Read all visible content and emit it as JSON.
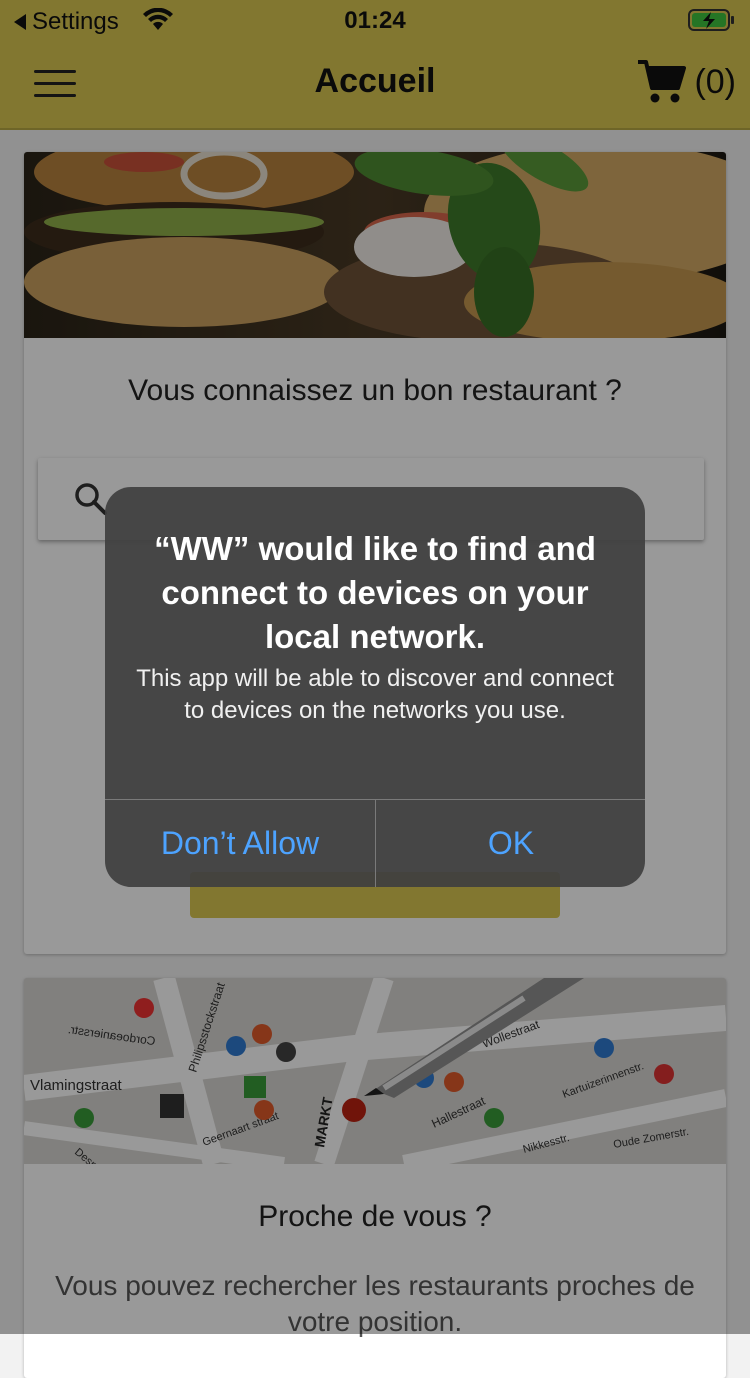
{
  "status_bar": {
    "back_label": "Settings",
    "time": "01:24"
  },
  "navbar": {
    "title": "Accueil",
    "cart_count": "(0)"
  },
  "card1": {
    "title": "Vous connaissez un bon restaurant ?"
  },
  "card2": {
    "title": "Proche de vous ?",
    "text": "Vous pouvez rechercher les restaurants proches de votre position."
  },
  "map_labels": [
    "Vlamingstraat",
    "Philipsstockstraat",
    "Cordoeaniersstr.",
    "Geernaart straat",
    "MARKT",
    "Hallestraat",
    "Wollestraat",
    "Despaarsestr.",
    "Oude Zomerstr.",
    "Kartuizerinnenstr.",
    "Nikkesstr."
  ],
  "alert": {
    "title": "“WW” would like to find and connect to devices on your local network.",
    "message": "This app will be able to discover and connect to devices on the networks you use.",
    "deny_label": "Don’t Allow",
    "ok_label": "OK"
  },
  "colors": {
    "brand_yellow": "#d9c650",
    "alert_button": "#4da3ff"
  }
}
